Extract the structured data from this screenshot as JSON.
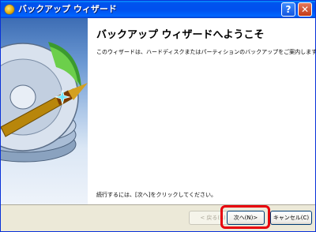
{
  "window": {
    "title": "バックアップ ウィザード"
  },
  "titlebar_buttons": {
    "help_label": "?",
    "close_label": "✕"
  },
  "main": {
    "heading": "バックアップ ウィザードへようこそ",
    "intro": "このウィザードは、ハードディスクまたはパーティションのバックアップをご案内します。",
    "continue_text": "続行するには、[次へ]をクリックしてください。"
  },
  "buttons": {
    "back": "< 戻る(B)",
    "next": "次へ(N)>",
    "cancel": "キャンセル(C)"
  },
  "colors": {
    "titlebar": "#0054e3",
    "highlight": "#e8000b",
    "dialog_bg": "#ece9d8"
  },
  "icons": {
    "wizard_image": "hard-disk-drill-icon"
  }
}
